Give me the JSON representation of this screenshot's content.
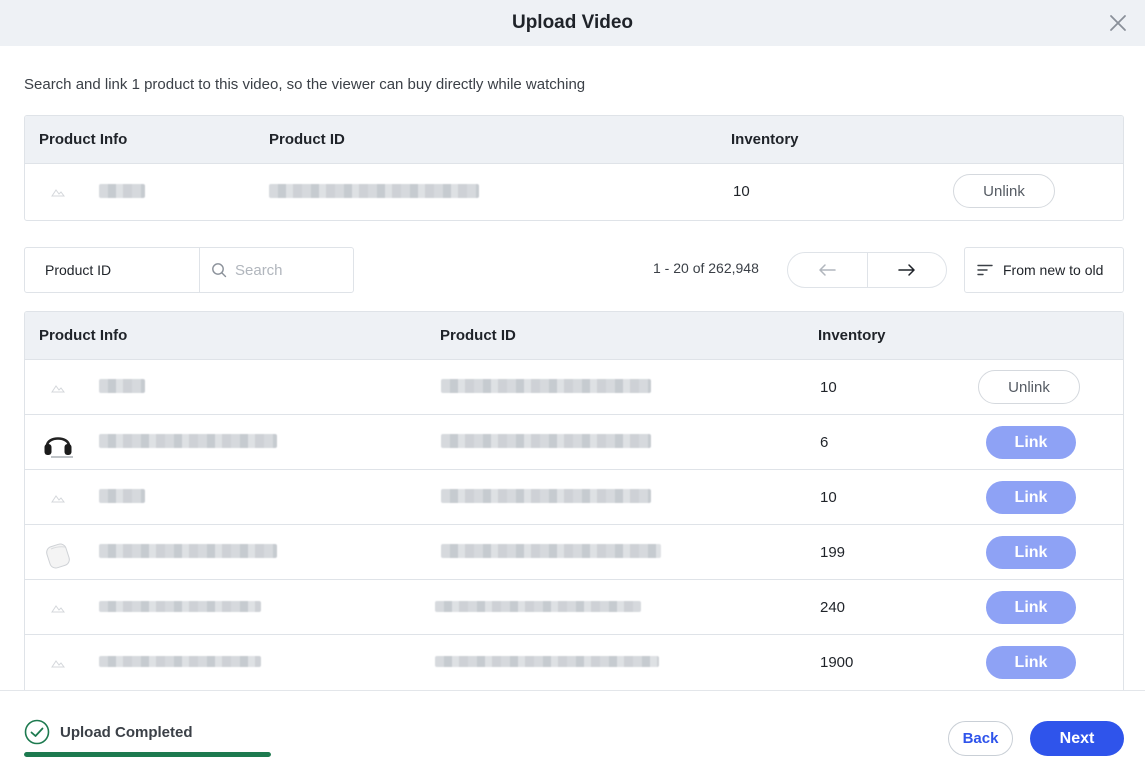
{
  "modal": {
    "title": "Upload Video",
    "subtitle": "Search and link 1 product to this video, so the viewer can buy directly while watching"
  },
  "linked_table": {
    "columns": [
      "Product Info",
      "Product ID",
      "Inventory"
    ],
    "rows": [
      {
        "image": "placeholder-icon",
        "inventory": "10",
        "action": "Unlink"
      }
    ]
  },
  "filter": {
    "field": "Product ID",
    "search_placeholder": "Search"
  },
  "pagination": {
    "range_text": "1 - 20 of 262,948",
    "prev_icon": "arrow-left-icon",
    "next_icon": "arrow-right-icon"
  },
  "sort": {
    "label": "From new to old",
    "icon": "sort-lines-icon"
  },
  "product_table": {
    "columns": [
      "Product Info",
      "Product ID",
      "Inventory"
    ],
    "rows": [
      {
        "image": "placeholder-icon",
        "inventory": "10",
        "action": "Unlink"
      },
      {
        "image": "headphones-icon",
        "inventory": "6",
        "action": "Link"
      },
      {
        "image": "placeholder-icon",
        "inventory": "10",
        "action": "Link"
      },
      {
        "image": "earbuds-case-icon",
        "inventory": "199",
        "action": "Link"
      },
      {
        "image": "placeholder-icon",
        "inventory": "240",
        "action": "Link"
      },
      {
        "image": "placeholder-icon",
        "inventory": "1900",
        "action": "Link"
      }
    ]
  },
  "footer": {
    "upload_status": "Upload Completed",
    "upload_progress": 1.0,
    "back_label": "Back",
    "next_label": "Next"
  },
  "colors": {
    "primary": "#2f54eb",
    "link_button": "#8ea2f5",
    "success": "#1d7a4f",
    "header_bg": "#eef1f5"
  }
}
